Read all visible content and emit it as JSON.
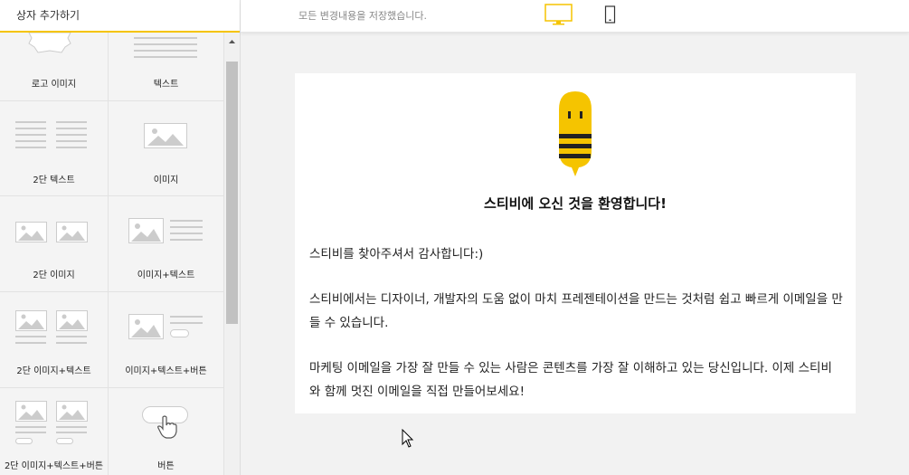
{
  "left_panel": {
    "title": "상자 추가하기",
    "tiles": [
      {
        "label": "로고 이미지"
      },
      {
        "label": "텍스트"
      },
      {
        "label": "2단 텍스트"
      },
      {
        "label": "이미지"
      },
      {
        "label": "2단 이미지"
      },
      {
        "label": "이미지+텍스트"
      },
      {
        "label": "2단 이미지+텍스트"
      },
      {
        "label": "이미지+텍스트+버튼"
      },
      {
        "label": "2단 이미지+텍스트+버튼"
      },
      {
        "label": "버튼"
      }
    ]
  },
  "topbar": {
    "status": "모든 변경내용을 저장했습니다.",
    "desktop_icon": "monitor-icon",
    "mobile_icon": "phone-icon",
    "accent_color": "#f5c400"
  },
  "email": {
    "title": "스티비에 오신 것을 환영합니다!",
    "paragraphs": [
      "스티비를 찾아주셔서 감사합니다:)",
      "스티비에서는 디자이너, 개발자의 도움 없이 마치 프레젠테이션을 만드는 것처럼 쉽고 빠르게 이메일을 만들 수 있습니다.",
      "마케팅 이메일을 가장 잘 만들 수 있는 사람은 콘텐츠를 가장 잘 이해하고 있는 당신입니다. 이제 스티비와 함께 멋진 이메일을 직접 만들어보세요!"
    ]
  }
}
